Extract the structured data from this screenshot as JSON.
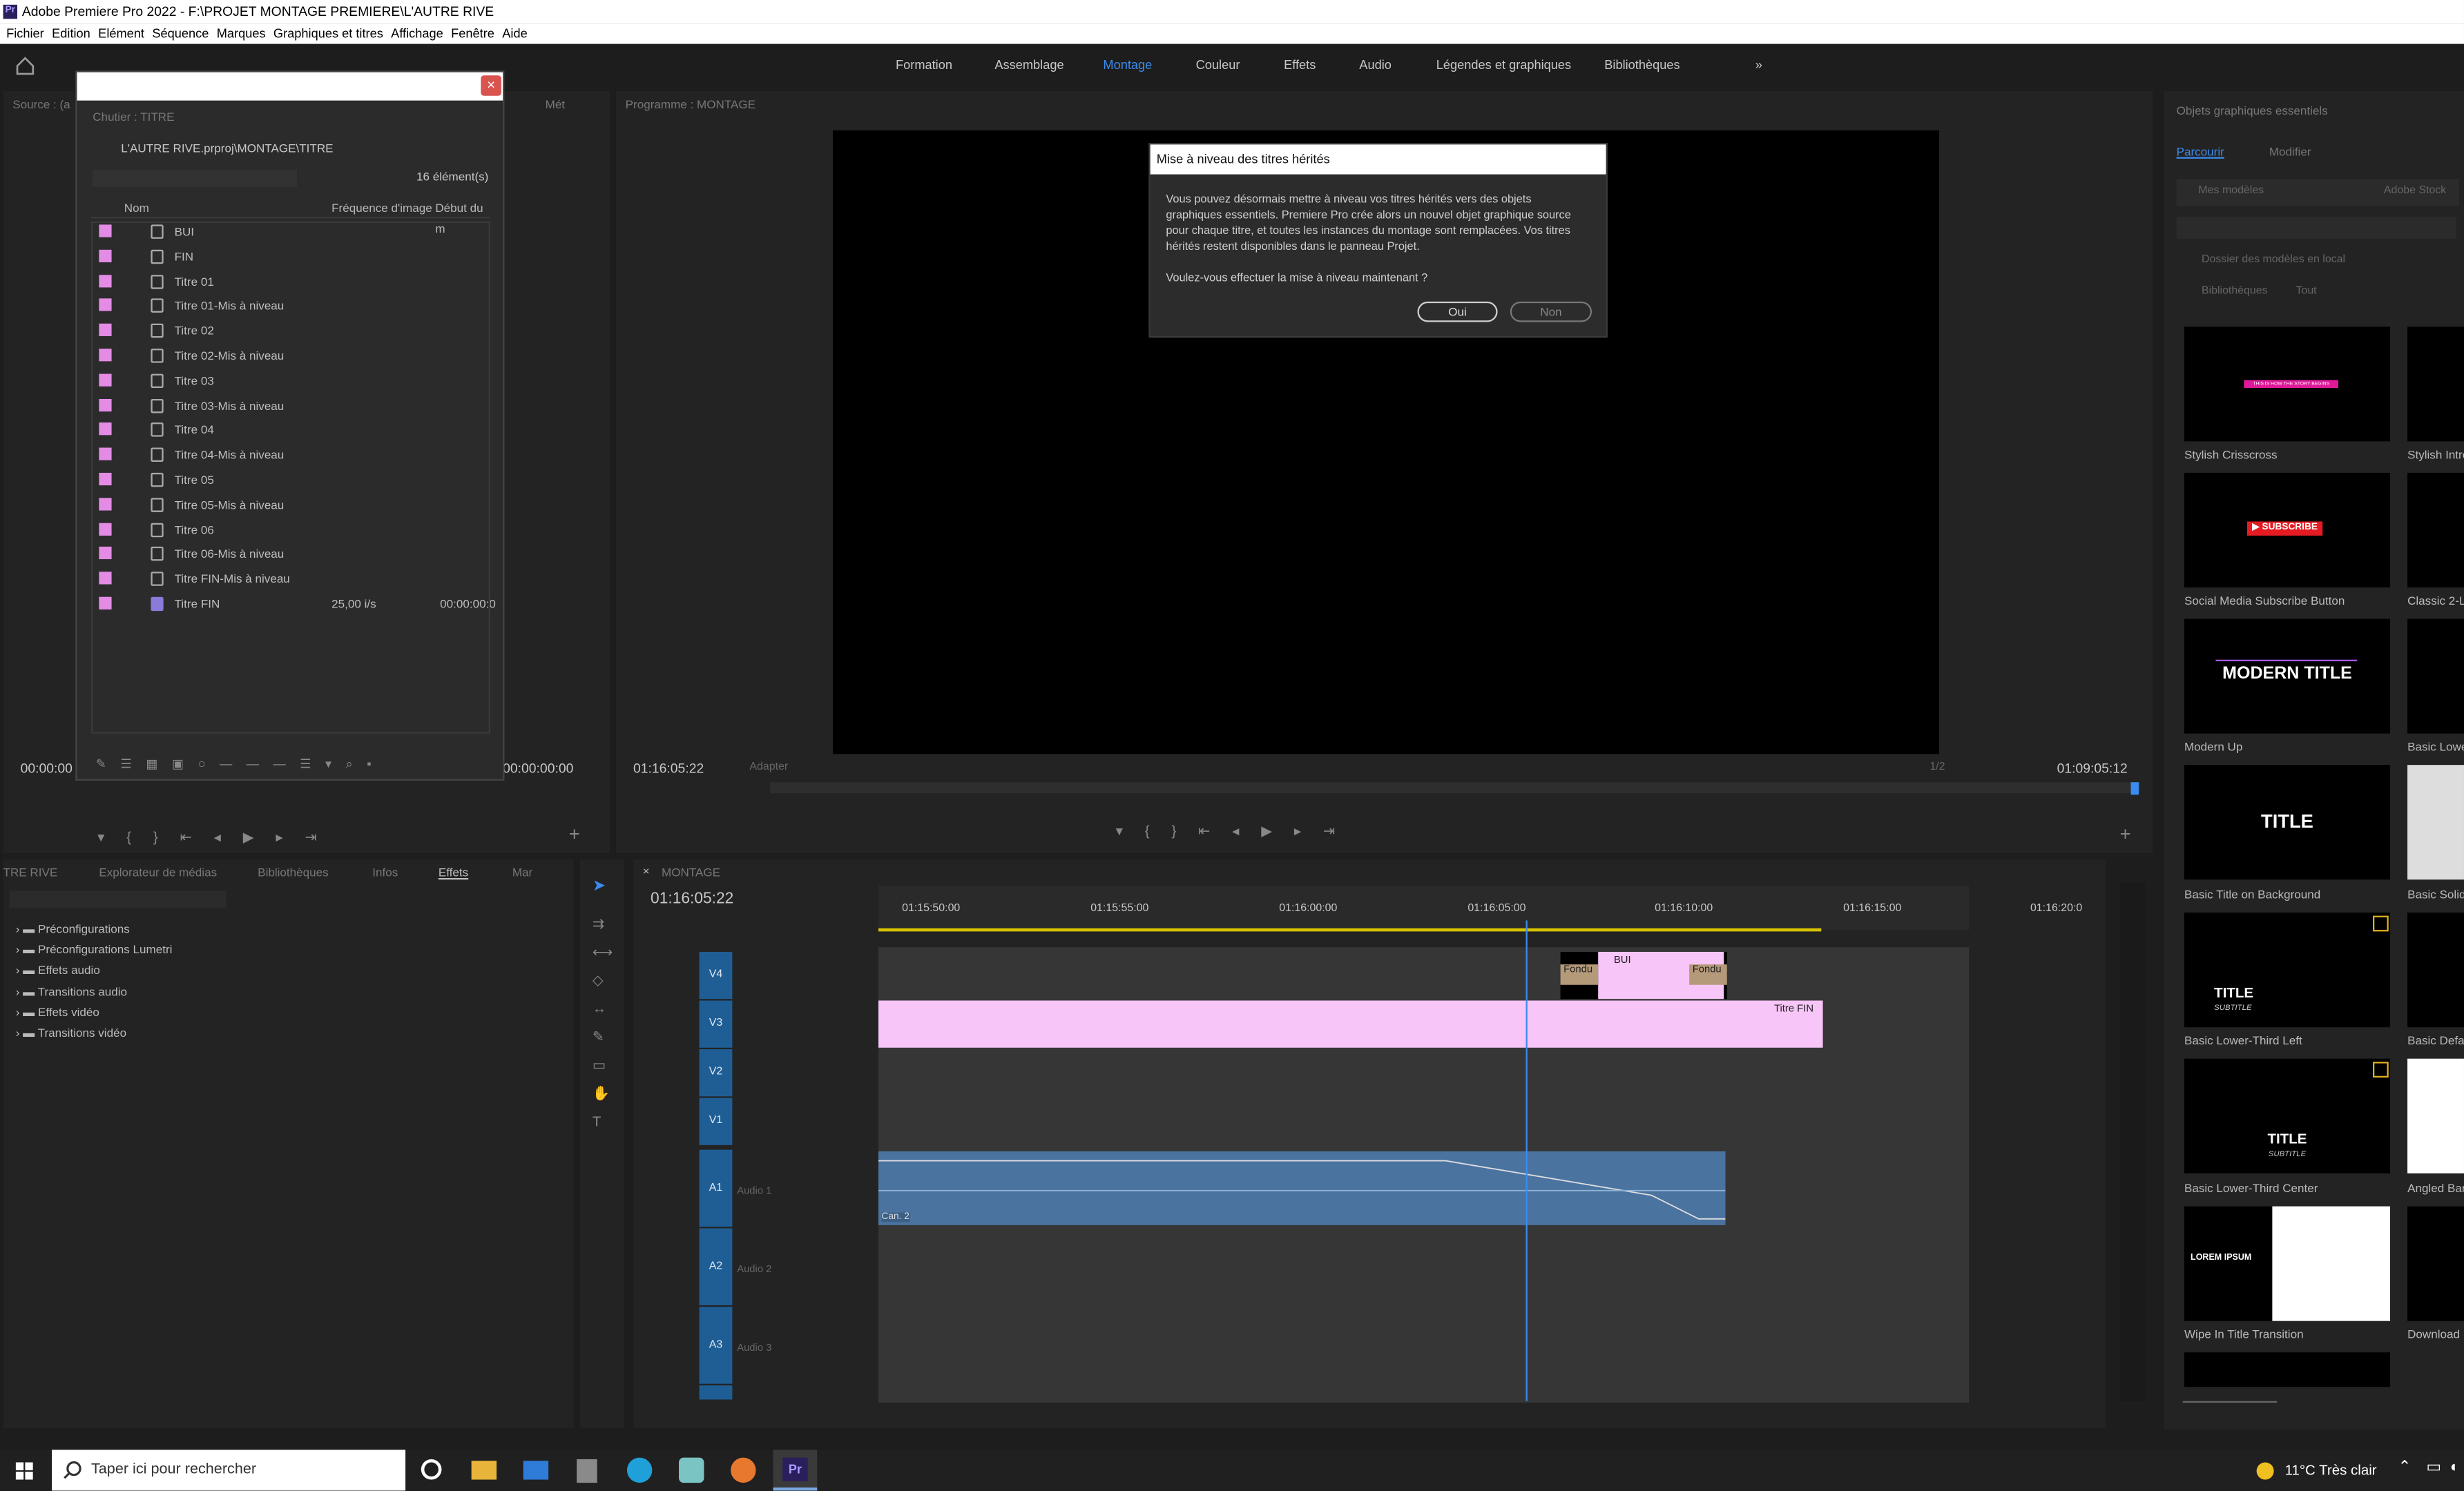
{
  "app": {
    "title": "Adobe Premiere Pro 2022 - F:\\PROJET MONTAGE PREMIERE\\L'AUTRE RIVE",
    "logo": "Pr"
  },
  "menu": [
    "Fichier",
    "Edition",
    "Elément",
    "Séquence",
    "Marques",
    "Graphiques et titres",
    "Affichage",
    "Fenêtre",
    "Aide"
  ],
  "workspaces": [
    {
      "label": "Formation"
    },
    {
      "label": "Assemblage"
    },
    {
      "label": "Montage",
      "active": true
    },
    {
      "label": "Couleur"
    },
    {
      "label": "Effets"
    },
    {
      "label": "Audio"
    },
    {
      "label": "Légendes et graphiques"
    },
    {
      "label": "Bibliothèques"
    }
  ],
  "source_panel": {
    "tab": "Source : (a",
    "tab2": "Mét",
    "timecode_left": "00:00:00",
    "timecode_right": "00:00:00:00"
  },
  "bin": {
    "tab": "Chutier : TITRE",
    "path": "L'AUTRE RIVE.prproj\\MONTAGE\\TITRE",
    "count": "16 élément(s)",
    "columns": {
      "name": "Nom",
      "fps": "Fréquence d'image",
      "start": "Début du m"
    },
    "items": [
      {
        "name": "BUI"
      },
      {
        "name": "FIN"
      },
      {
        "name": "Titre 01"
      },
      {
        "name": "Titre 01-Mis à niveau"
      },
      {
        "name": "Titre 02"
      },
      {
        "name": "Titre 02-Mis à niveau"
      },
      {
        "name": "Titre 03"
      },
      {
        "name": "Titre 03-Mis à niveau"
      },
      {
        "name": "Titre 04"
      },
      {
        "name": "Titre 04-Mis à niveau"
      },
      {
        "name": "Titre 05"
      },
      {
        "name": "Titre 05-Mis à niveau"
      },
      {
        "name": "Titre 06"
      },
      {
        "name": "Titre 06-Mis à niveau"
      },
      {
        "name": "Titre FIN-Mis à niveau"
      },
      {
        "name": "Titre FIN",
        "fps": "25,00 i/s",
        "start": "00:00:00:0"
      }
    ]
  },
  "program": {
    "tab": "Programme : MONTAGE",
    "timecode": "01:16:05:22",
    "fit": "Adapter",
    "quality": "1/2",
    "duration": "01:09:05:12"
  },
  "dialog": {
    "title": "Mise à niveau des titres hérités",
    "body": "Vous pouvez désormais mettre à niveau vos titres hérités vers des objets graphiques essentiels. Premiere Pro crée alors un nouvel objet graphique source pour chaque titre, et toutes les instances du montage sont remplacées. Vos titres hérités restent disponibles dans le panneau Projet.",
    "question": "Voulez-vous effectuer la mise à niveau maintenant ?",
    "yes": "Oui",
    "no": "Non"
  },
  "effects": {
    "tabs": [
      "TRE RIVE",
      "Explorateur de médias",
      "Bibliothèques",
      "Infos",
      "Effets",
      "Mar"
    ],
    "items": [
      "Préconfigurations",
      "Préconfigurations Lumetri",
      "Effets audio",
      "Transitions audio",
      "Effets vidéo",
      "Transitions vidéo"
    ]
  },
  "timeline": {
    "tab": "MONTAGE",
    "timecode": "01:16:05:22",
    "ruler": [
      "01:15:50:00",
      "01:15:55:00",
      "01:16:00:00",
      "01:16:05:00",
      "01:16:10:00",
      "01:16:15:00",
      "01:16:20:0"
    ],
    "tracks": [
      "V4",
      "V3",
      "V2",
      "V1",
      "A1",
      "A2",
      "A3"
    ],
    "audio_names": [
      "Audio 1",
      "Audio 2",
      "Audio 3"
    ],
    "clips": {
      "bui": "BUI",
      "fondu1": "Fondu",
      "fondu2": "Fondu",
      "titre_fin": "Titre FIN",
      "audio": "Can. 2"
    }
  },
  "essential_graphics": {
    "title": "Objets graphiques essentiels",
    "tabs": [
      "Parcourir",
      "Modifier"
    ],
    "subtabs": [
      "Mes modèles",
      "Adobe Stock"
    ],
    "local_folder": "Dossier des modèles en local",
    "libraries": "Bibliothèques",
    "filter": "Tout",
    "templates": [
      {
        "name": "Stylish Crisscross",
        "text": "THIS IS HOW THE STORY BEGINS"
      },
      {
        "name": "Social Media Subscribe Button",
        "text": "▶ SUBSCRIBE"
      },
      {
        "name": "Modern Up",
        "text": "MODERN TITLE"
      },
      {
        "name": "Basic Title on Background",
        "text": "TITLE"
      },
      {
        "name": "Basic Lower-Third Left",
        "text": "TITLE",
        "sub": "SUBTITLE"
      },
      {
        "name": "Basic Lower-Third Center",
        "text": "TITLE",
        "sub": "SUBTITLE"
      },
      {
        "name": "Wipe In Title Transition",
        "text": "LOREM IPSUM"
      }
    ],
    "templates_right": [
      "Stylish Intro",
      "Classic 2-Li",
      "Basic Lowe",
      "Basic Solid",
      "Basic Defau",
      "Angled Bar",
      "Download"
    ]
  },
  "taskbar": {
    "search": "Taper ici pour rechercher",
    "weather": "11°C Très clair"
  },
  "colors": {
    "accent": "#3a8cf0",
    "label_pink": "#e48be6",
    "clip_pink": "#f7c5f7",
    "track_blue": "#1f5e95",
    "audio_clip": "#4a73a0"
  }
}
